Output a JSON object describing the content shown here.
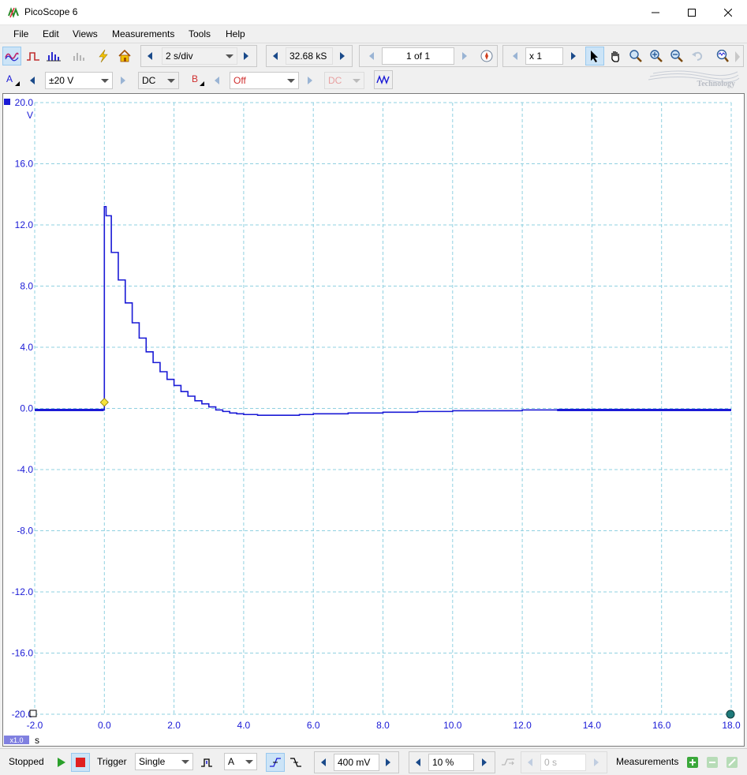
{
  "window": {
    "title": "PicoScope 6"
  },
  "menu": [
    "File",
    "Edit",
    "Views",
    "Measurements",
    "Tools",
    "Help"
  ],
  "toolbar": {
    "timebase": "2 s/div",
    "samples": "32.68 kS",
    "buffer": "1 of 1",
    "zoom_factor": "x 1",
    "brand_text": "Technology"
  },
  "channel_a": {
    "label": "A",
    "range": "±20 V",
    "coupling": "DC"
  },
  "channel_b": {
    "label": "B",
    "range": "Off",
    "coupling": "DC"
  },
  "status": {
    "state": "Stopped",
    "trigger_label": "Trigger",
    "trigger_mode": "Single",
    "trigger_source": "A",
    "threshold": "400 mV",
    "pretrigger": "10 %",
    "delay": "0 s",
    "measurements_label": "Measurements"
  },
  "plot": {
    "y_unit": "V",
    "x_unit": "s",
    "x_zoom": "x1.0"
  },
  "colors": {
    "trace": "#1a1ad6",
    "grid": "#8fd0e0",
    "trigger_marker": "#f5e33b"
  },
  "chart_data": {
    "type": "line",
    "xlabel": "s",
    "ylabel": "V",
    "xlim": [
      -2.0,
      18.0
    ],
    "ylim": [
      -20.0,
      20.0
    ],
    "x_ticks": [
      "-2.0",
      "0.0",
      "2.0",
      "4.0",
      "6.0",
      "8.0",
      "10.0",
      "12.0",
      "14.0",
      "16.0",
      "18.0"
    ],
    "y_ticks": [
      "20.0",
      "16.0",
      "12.0",
      "8.0",
      "4.0",
      "0.0",
      "-4.0",
      "-8.0",
      "-12.0",
      "-16.0",
      "-20.0"
    ],
    "grid": true,
    "series": [
      {
        "x": [
          -2.0,
          -0.05,
          -0.02,
          0.0,
          0.05,
          0.2,
          0.4,
          0.6,
          0.8,
          1.0,
          1.2,
          1.4,
          1.6,
          1.8,
          2.0,
          2.2,
          2.4,
          2.6,
          2.8,
          3.0,
          3.2,
          3.4,
          3.6,
          3.8,
          4.0,
          4.4,
          5.0,
          5.6,
          6.0,
          7.0,
          8.0,
          9.0,
          10.0,
          12.0,
          14.0,
          16.0,
          18.0
        ],
        "y": [
          -0.1,
          -0.1,
          -0.1,
          13.2,
          12.6,
          10.2,
          8.4,
          6.9,
          5.6,
          4.6,
          3.7,
          3.0,
          2.4,
          1.9,
          1.5,
          1.1,
          0.8,
          0.5,
          0.3,
          0.1,
          -0.1,
          -0.2,
          -0.3,
          -0.35,
          -0.4,
          -0.45,
          -0.45,
          -0.4,
          -0.35,
          -0.3,
          -0.25,
          -0.2,
          -0.15,
          -0.1,
          -0.1,
          -0.1,
          -0.1
        ]
      }
    ],
    "trigger_point": {
      "x": 0.0,
      "y": 0.4
    }
  }
}
